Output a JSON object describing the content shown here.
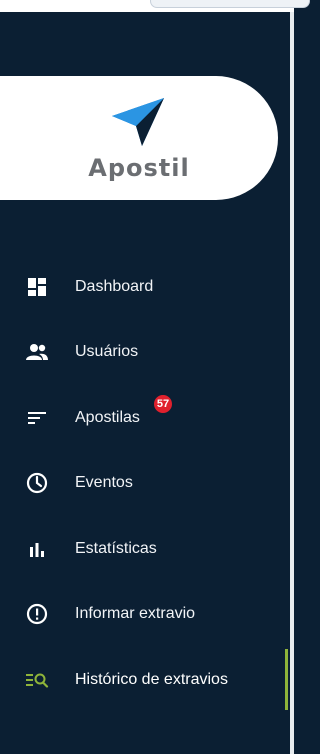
{
  "brand": {
    "name": "Apostil"
  },
  "nav": {
    "items": [
      {
        "label": "Dashboard",
        "icon": "dashboard-icon"
      },
      {
        "label": "Usuários",
        "icon": "users-icon"
      },
      {
        "label": "Apostilas",
        "icon": "list-icon",
        "badge": "57"
      },
      {
        "label": "Eventos",
        "icon": "clock-icon"
      },
      {
        "label": "Estatísticas",
        "icon": "bar-chart-icon"
      },
      {
        "label": "Informar extravio",
        "icon": "alert-icon"
      },
      {
        "label": "Histórico de extravios",
        "icon": "history-search-icon",
        "active": true
      }
    ]
  },
  "colors": {
    "sidebar_bg": "#0b1f33",
    "badge": "#e0202d",
    "active_accent": "#8fb43a",
    "logo_blue": "#1a7fd0",
    "logo_dark": "#0b1f33"
  }
}
